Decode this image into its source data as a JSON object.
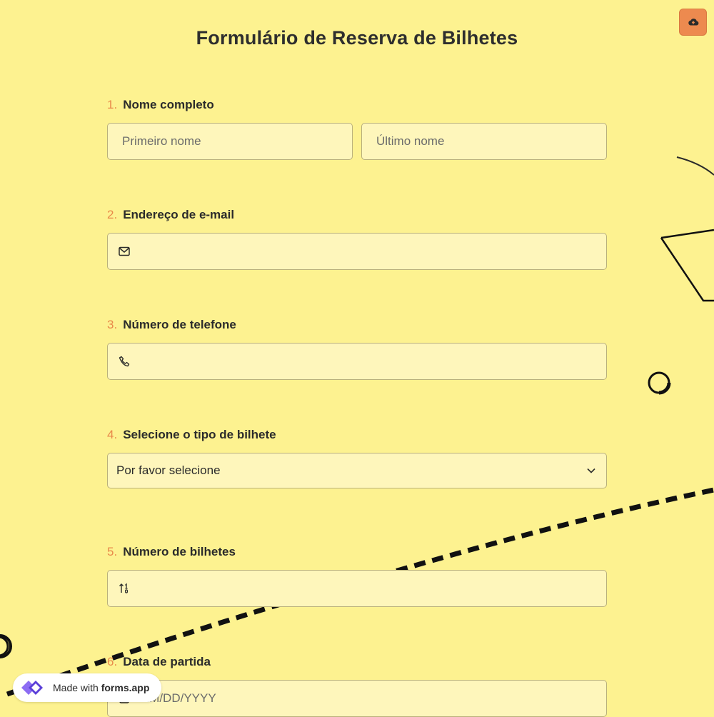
{
  "page": {
    "title": "Formulário de Reserva de Bilhetes",
    "accent_color": "#e8894a",
    "background_color": "#fdf290"
  },
  "toolbar": {
    "upload_icon": "cloud-upload-icon"
  },
  "questions": [
    {
      "number": "1.",
      "label": "Nome completo",
      "fields": [
        {
          "placeholder": "Primeiro nome"
        },
        {
          "placeholder": "Último nome"
        }
      ]
    },
    {
      "number": "2.",
      "label": "Endereço de e-mail",
      "icon": "envelope-icon",
      "value": ""
    },
    {
      "number": "3.",
      "label": "Número de telefone",
      "icon": "phone-icon",
      "value": ""
    },
    {
      "number": "4.",
      "label": "Selecione o tipo de bilhete",
      "selected": "Por favor selecione",
      "icon": "chevron-down-icon"
    },
    {
      "number": "5.",
      "label": "Número de bilhetes",
      "icon": "sort-number-icon",
      "value": ""
    },
    {
      "number": "6.",
      "label": "Data de partida",
      "icon": "calendar-icon",
      "placeholder": "MM/DD/YYYY"
    }
  ],
  "footer_badge": {
    "prefix": "Made with",
    "brand": "forms.app",
    "icon": "forms-app-logo-icon"
  }
}
